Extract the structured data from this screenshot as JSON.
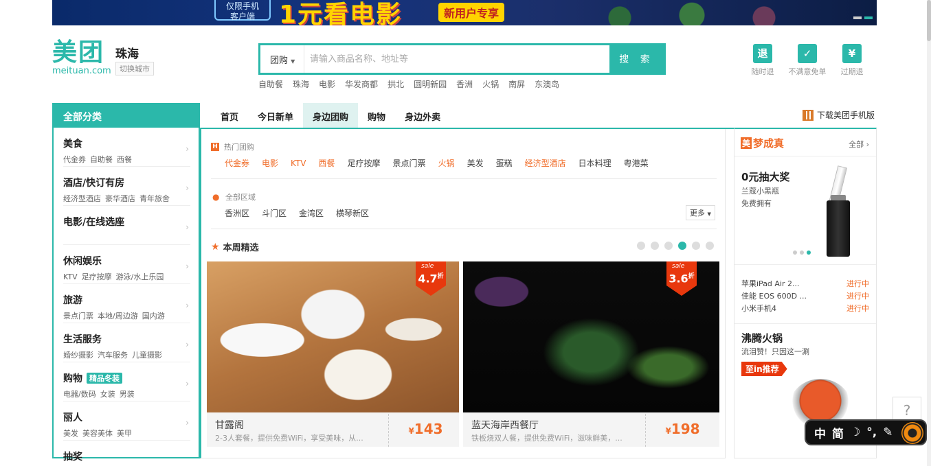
{
  "banner": {
    "badge_line1": "仅限手机",
    "badge_line2": "客户端",
    "headline": "1元看电影",
    "tag": "新用户专享"
  },
  "header": {
    "logo_cn": "美团",
    "logo_en": "meituan.com",
    "city": "珠海",
    "switch_city": "切换城市"
  },
  "search": {
    "category": "团购",
    "placeholder": "请输入商品名称、地址等",
    "button": "搜 索",
    "hot_words": [
      "自助餐",
      "珠海",
      "电影",
      "华发商都",
      "拱北",
      "圆明新园",
      "香洲",
      "火锅",
      "南屏",
      "东澳岛"
    ]
  },
  "guarantees": [
    {
      "icon": "退",
      "label": "随时退"
    },
    {
      "icon": "✓",
      "label": "不满意免单"
    },
    {
      "icon": "¥",
      "label": "过期退"
    }
  ],
  "nav": {
    "all_categories": "全部分类",
    "tabs": [
      {
        "label": "首页",
        "active": false
      },
      {
        "label": "今日新单",
        "active": false
      },
      {
        "label": "身边团购",
        "active": true
      },
      {
        "label": "购物",
        "active": false
      },
      {
        "label": "身边外卖",
        "active": false
      }
    ],
    "app_download": "下载美团手机版"
  },
  "sidebar": {
    "categories": [
      {
        "title": "美食",
        "subs": [
          "代金券",
          "自助餐",
          "西餐"
        ]
      },
      {
        "title": "酒店/快订有房",
        "subs": [
          "经济型酒店",
          "豪华酒店",
          "青年旅舍"
        ]
      },
      {
        "title": "电影/在线选座",
        "subs": []
      },
      {
        "title": "休闲娱乐",
        "subs": [
          "KTV",
          "足疗按摩",
          "游泳/水上乐园"
        ]
      },
      {
        "title": "旅游",
        "subs": [
          "景点门票",
          "本地/周边游",
          "国内游"
        ]
      },
      {
        "title": "生活服务",
        "subs": [
          "婚纱摄影",
          "汽车服务",
          "儿童摄影"
        ]
      },
      {
        "title": "购物",
        "badge": "精品冬装",
        "subs": [
          "电器/数码",
          "女装",
          "男装"
        ]
      },
      {
        "title": "丽人",
        "subs": [
          "美发",
          "美容美体",
          "美甲"
        ]
      },
      {
        "title": "抽奖",
        "subs": []
      }
    ]
  },
  "main": {
    "hot_label": "热门团购",
    "hot_tags": [
      {
        "label": "代金券",
        "hot": true
      },
      {
        "label": "电影",
        "hot": true
      },
      {
        "label": "KTV",
        "hot": true
      },
      {
        "label": "西餐",
        "hot": true
      },
      {
        "label": "足疗按摩",
        "hot": false
      },
      {
        "label": "景点门票",
        "hot": false
      },
      {
        "label": "火锅",
        "hot": true
      },
      {
        "label": "美发",
        "hot": false
      },
      {
        "label": "蛋糕",
        "hot": false
      },
      {
        "label": "经济型酒店",
        "hot": true
      },
      {
        "label": "日本料理",
        "hot": false
      },
      {
        "label": "粤港菜",
        "hot": false
      }
    ],
    "area_label": "全部区域",
    "areas": [
      "香洲区",
      "斗门区",
      "金湾区",
      "横琴新区"
    ],
    "more": "更多",
    "weekly_title": "本周精选",
    "carousel_active": 4,
    "carousel_count": 6,
    "deals": [
      {
        "name": "甘露阁",
        "desc": "2-3人套餐，提供免费WiFi，享受美味，从...",
        "price": "143",
        "discount": "4.7",
        "sale": "sale",
        "zhe": "折"
      },
      {
        "name": "蓝天海岸西餐厅",
        "desc": "铁板烧双人餐，提供免费WiFi，滋味鲜美，...",
        "price": "198",
        "discount": "3.6",
        "sale": "sale",
        "zhe": "折"
      }
    ],
    "currency": "¥"
  },
  "rightbar": {
    "title_mei": "美",
    "title_rest": "梦成真",
    "all": "全部",
    "prize_title": "0元抽大奖",
    "prize_sub1": "兰蔻小黑瓶",
    "prize_sub2": "免费拥有",
    "auctions": [
      {
        "item": "苹果iPad Air 2...",
        "status": "进行中"
      },
      {
        "item": "佳能 EOS 600D ...",
        "status": "进行中"
      },
      {
        "item": "小米手机4",
        "status": "进行中"
      }
    ],
    "promo_title": "沸腾火锅",
    "promo_sub": "流泪赞！只因这一涮",
    "promo_tag": "至in推荐"
  },
  "ime": {
    "chars": [
      "中",
      "简",
      "☽",
      "°,",
      "✎"
    ]
  },
  "help": "?"
}
